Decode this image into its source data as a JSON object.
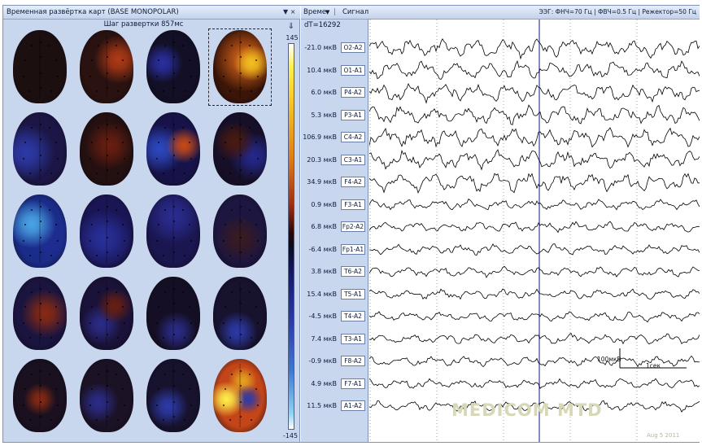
{
  "map_panel": {
    "title": "Временная развёртка карт (BASE MONOPOLAR)",
    "title_controls": "▼ ×",
    "scan_step": "Шаг развертки 857мс",
    "scale_max": "145",
    "scale_min": "-145",
    "scale_icon": "electrode-icon",
    "maps": [
      {
        "bg": "#1c0f10",
        "spots": []
      },
      {
        "bg": "#2a1210",
        "spots": [
          {
            "c": "#b13a16",
            "x": 72,
            "y": 40,
            "r": 30
          }
        ]
      },
      {
        "bg": "#120f26",
        "spots": [
          {
            "c": "#2a2fa0",
            "x": 30,
            "y": 45,
            "r": 25
          }
        ]
      },
      {
        "bg": "#3a1508",
        "spots": [
          {
            "c": "#f2c21e",
            "x": 72,
            "y": 45,
            "r": 22
          },
          {
            "c": "#d06018",
            "x": 60,
            "y": 40,
            "r": 40
          }
        ]
      },
      {
        "bg": "#1b1646",
        "spots": [
          {
            "c": "#2d3aa8",
            "x": 25,
            "y": 55,
            "r": 35
          }
        ]
      },
      {
        "bg": "#241010",
        "spots": [
          {
            "c": "#6a1e10",
            "x": 55,
            "y": 45,
            "r": 30
          }
        ]
      },
      {
        "bg": "#17134a",
        "spots": [
          {
            "c": "#c94a18",
            "x": 70,
            "y": 45,
            "r": 22
          },
          {
            "c": "#2d48c0",
            "x": 25,
            "y": 50,
            "r": 30
          }
        ]
      },
      {
        "bg": "#160f28",
        "spots": [
          {
            "c": "#4a1a10",
            "x": 40,
            "y": 40,
            "r": 25
          },
          {
            "c": "#24288c",
            "x": 75,
            "y": 60,
            "r": 30
          }
        ]
      },
      {
        "bg": "#1a2c8a",
        "spots": [
          {
            "c": "#4aa6e6",
            "x": 35,
            "y": 40,
            "r": 30
          },
          {
            "c": "#1f2c90",
            "x": 70,
            "y": 60,
            "r": 30
          }
        ]
      },
      {
        "bg": "#1a1656",
        "spots": [
          {
            "c": "#28309a",
            "x": 45,
            "y": 60,
            "r": 35
          }
        ]
      },
      {
        "bg": "#1a1650",
        "spots": [
          {
            "c": "#2a2c90",
            "x": 50,
            "y": 30,
            "r": 35
          }
        ]
      },
      {
        "bg": "#1c1640",
        "spots": [
          {
            "c": "#3a1a20",
            "x": 50,
            "y": 60,
            "r": 30
          }
        ]
      },
      {
        "bg": "#1a1440",
        "spots": [
          {
            "c": "#8a2a12",
            "x": 60,
            "y": 50,
            "r": 30
          }
        ]
      },
      {
        "bg": "#1a1238",
        "spots": [
          {
            "c": "#6a1f10",
            "x": 65,
            "y": 40,
            "r": 22
          },
          {
            "c": "#2b2c8a",
            "x": 40,
            "y": 65,
            "r": 25
          }
        ]
      },
      {
        "bg": "#140f24",
        "spots": [
          {
            "c": "#2b2c8a",
            "x": 55,
            "y": 75,
            "r": 25
          }
        ]
      },
      {
        "bg": "#17122e",
        "spots": [
          {
            "c": "#2d3aa8",
            "x": 45,
            "y": 75,
            "r": 25
          }
        ]
      },
      {
        "bg": "#1a1020",
        "spots": [
          {
            "c": "#8a2a12",
            "x": 50,
            "y": 55,
            "r": 20
          }
        ]
      },
      {
        "bg": "#1b1226",
        "spots": [
          {
            "c": "#2b2c8a",
            "x": 35,
            "y": 60,
            "r": 25
          }
        ]
      },
      {
        "bg": "#17122e",
        "spots": [
          {
            "c": "#2d3aa8",
            "x": 40,
            "y": 65,
            "r": 25
          }
        ]
      },
      {
        "bg": "#c34518",
        "spots": [
          {
            "c": "#fff04a",
            "x": 25,
            "y": 55,
            "r": 22
          },
          {
            "c": "#2d3aa8",
            "x": 65,
            "y": 55,
            "r": 18
          },
          {
            "c": "#e6a31e",
            "x": 55,
            "y": 30,
            "r": 18
          }
        ]
      }
    ]
  },
  "signal_panel": {
    "time_label": "Време",
    "time_arrow": "▼",
    "signal_label": "Сигнал",
    "filters": "ЭЭГ: ФНЧ=70 Гц | ФВЧ=0.5 Гц | Режектор=50 Гц",
    "dt": "dT=16292",
    "channels": [
      {
        "value": "-21.0 мкВ",
        "name": "O2-A2"
      },
      {
        "value": "10.4 мкВ",
        "name": "O1-A1"
      },
      {
        "value": "6.0 мкВ",
        "name": "P4-A2"
      },
      {
        "value": "5.3 мкВ",
        "name": "P3-A1"
      },
      {
        "value": "106.9 мкВ",
        "name": "C4-A2"
      },
      {
        "value": "20.3 мкВ",
        "name": "C3-A1"
      },
      {
        "value": "34.9 мкВ",
        "name": "F4-A2"
      },
      {
        "value": "0.9 мкВ",
        "name": "F3-A1"
      },
      {
        "value": "6.8 мкВ",
        "name": "Fp2-A2"
      },
      {
        "value": "-6.4 мкВ",
        "name": "Fp1-A1"
      },
      {
        "value": "3.8 мкВ",
        "name": "T6-A2"
      },
      {
        "value": "15.4 мкВ",
        "name": "T5-A1"
      },
      {
        "value": "-4.5 мкВ",
        "name": "T4-A2"
      },
      {
        "value": "7.4 мкВ",
        "name": "T3-A1"
      },
      {
        "value": "-0.9 мкВ",
        "name": "F8-A2"
      },
      {
        "value": "4.9 мкВ",
        "name": "F7-A1"
      },
      {
        "value": "11.5 мкВ",
        "name": "A1-A2"
      }
    ],
    "scale_amp": "100мкВ",
    "scale_time": "1сек"
  },
  "watermark": {
    "text": "MEDICOM MTD",
    "date": "Aug 5 2011"
  },
  "colors": {
    "panel_bg": "#c9d7ee",
    "header_bg": "#d4e0f3",
    "trace": "#000000",
    "cursor": "#3a3aa0"
  }
}
